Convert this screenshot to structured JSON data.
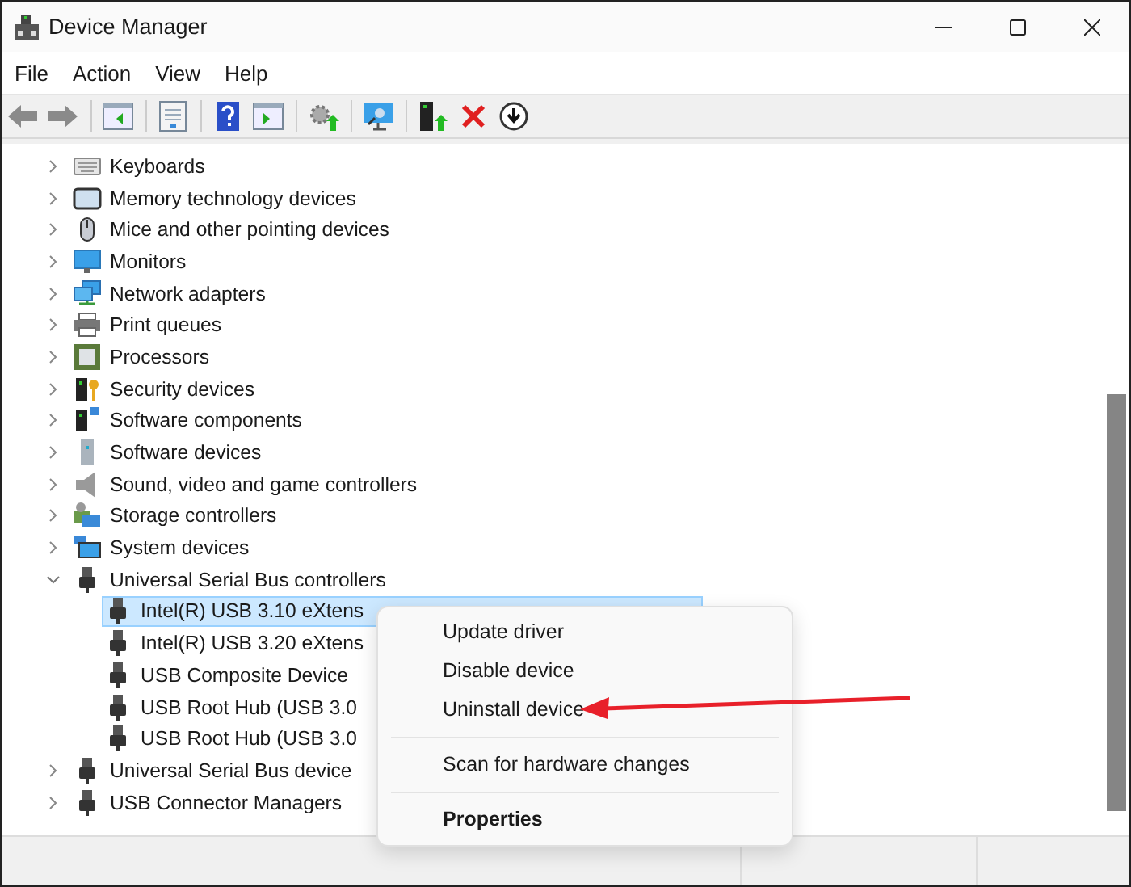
{
  "window": {
    "title": "Device Manager"
  },
  "menu_bar": [
    "File",
    "Action",
    "View",
    "Help"
  ],
  "tree": {
    "items": [
      {
        "label": "Keyboards",
        "kind": "keyboard",
        "expanded": false,
        "selected": false
      },
      {
        "label": "Memory technology devices",
        "kind": "memory",
        "expanded": false,
        "selected": false
      },
      {
        "label": "Mice and other pointing devices",
        "kind": "mouse",
        "expanded": false,
        "selected": false
      },
      {
        "label": "Monitors",
        "kind": "monitor",
        "expanded": false,
        "selected": false
      },
      {
        "label": "Network adapters",
        "kind": "network",
        "expanded": false,
        "selected": false
      },
      {
        "label": "Print queues",
        "kind": "printer",
        "expanded": false,
        "selected": false
      },
      {
        "label": "Processors",
        "kind": "processor",
        "expanded": false,
        "selected": false
      },
      {
        "label": "Security devices",
        "kind": "security",
        "expanded": false,
        "selected": false
      },
      {
        "label": "Software components",
        "kind": "component",
        "expanded": false,
        "selected": false
      },
      {
        "label": "Software devices",
        "kind": "software",
        "expanded": false,
        "selected": false
      },
      {
        "label": "Sound, video and game controllers",
        "kind": "sound",
        "expanded": false,
        "selected": false
      },
      {
        "label": "Storage controllers",
        "kind": "storage",
        "expanded": false,
        "selected": false
      },
      {
        "label": "System devices",
        "kind": "system",
        "expanded": false,
        "selected": false
      },
      {
        "label": "Universal Serial Bus controllers",
        "kind": "usb",
        "expanded": true,
        "selected": false,
        "children": [
          {
            "label": "Intel(R) USB 3.10 eXtens",
            "kind": "usb",
            "selected": true
          },
          {
            "label": "Intel(R) USB 3.20 eXtens",
            "kind": "usb",
            "selected": false
          },
          {
            "label": "USB Composite Device",
            "kind": "usb",
            "selected": false
          },
          {
            "label": "USB Root Hub (USB 3.0",
            "kind": "usb",
            "selected": false
          },
          {
            "label": "USB Root Hub (USB 3.0",
            "kind": "usb",
            "selected": false
          }
        ]
      },
      {
        "label": "Universal Serial Bus device",
        "kind": "usb",
        "expanded": false,
        "selected": false
      },
      {
        "label": "USB Connector Managers",
        "kind": "usb",
        "expanded": false,
        "selected": false
      }
    ]
  },
  "context_menu": {
    "groups": [
      [
        {
          "label": "Update driver",
          "default": false
        },
        {
          "label": "Disable device",
          "default": false
        },
        {
          "label": "Uninstall device",
          "default": false
        }
      ],
      [
        {
          "label": "Scan for hardware changes",
          "default": false
        }
      ],
      [
        {
          "label": "Properties",
          "default": true
        }
      ]
    ]
  }
}
